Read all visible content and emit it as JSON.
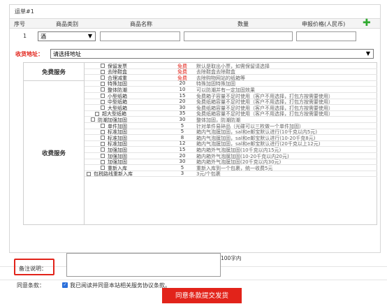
{
  "order": {
    "title": "运单#1",
    "headers": [
      "序号",
      "商品类别",
      "商品名称",
      "数量",
      "申报价格(人民币)"
    ],
    "row_index": "1",
    "category": "酒",
    "add_icon": "plus-icon"
  },
  "address": {
    "label": "收货地址：",
    "placeholder": "请选择地址"
  },
  "free_services": {
    "label": "免费服务",
    "items": [
      {
        "name": "保留发票",
        "price": "免费",
        "desc": "默认是取出小票，如需保留请选择"
      },
      {
        "name": "去除鞋盒",
        "price": "免费",
        "desc": "去除鞋盒去除鞋盒"
      },
      {
        "name": "合理减重",
        "price": "免费",
        "desc": "去除购物网站的纸箱等"
      }
    ]
  },
  "paid_services": {
    "label": "收费服务",
    "items": [
      {
        "name": "特殊加固",
        "price": "20",
        "desc": "特殊加固特殊加固"
      },
      {
        "name": "整体防潮",
        "price": "10",
        "desc": "可以防潮并有一定加固效果"
      },
      {
        "name": "小型纸箱",
        "price": "15",
        "desc": "免费箱子容量不足时使用（客户不用选择，打包方按需要使用）"
      },
      {
        "name": "中型纸箱",
        "price": "20",
        "desc": "免费纸箱容量不足时使用（客户不用选择，打包方按需要使用）"
      },
      {
        "name": "大型纸箱",
        "price": "30",
        "desc": "免费纸箱容量不足时使用（客户不用选择，打包方按需要使用）"
      },
      {
        "name": "超大型纸箱",
        "price": "35",
        "desc": "免费纸箱容量不足时使用（客户不用选择，打包方按需要使用）"
      },
      {
        "name": "防潮加强加固",
        "price": "30",
        "desc": "整体加固，防潮防潮"
      },
      {
        "name": "单件加固",
        "price": "5",
        "desc": "针对单件易碎品（光碟可以三枚做一个单件加固）"
      },
      {
        "name": "标准加固",
        "price": "5",
        "desc": "箱内气泡膜加固，sal和e邮宝默认进行(10千克以内5元)"
      },
      {
        "name": "标准加固",
        "price": "8",
        "desc": "箱内气泡膜加固，sal和e邮宝默认进行(10-20千克8元)"
      },
      {
        "name": "标准加固",
        "price": "12",
        "desc": "箱内气泡膜加固，sal和e邮宝默认进行(20千克以上12元)"
      },
      {
        "name": "加强加固",
        "price": "15",
        "desc": "箱内箱外气泡膜加固(10千克以内15元)"
      },
      {
        "name": "加强加固",
        "price": "20",
        "desc": "箱内箱外气泡膜加固(10-20千克以内20元)"
      },
      {
        "name": "加强加固",
        "price": "30",
        "desc": "箱内箱外气泡膜加固(20千克以内30元)"
      },
      {
        "name": "重新入库",
        "price": "5",
        "desc": "重新入库到一个包裹，统一收费5元"
      },
      {
        "name": "包税路线重新入库",
        "price": "3",
        "desc": "3元/个包裹"
      }
    ]
  },
  "note": {
    "label": "备注说明：",
    "limit": "100字内"
  },
  "agreement": {
    "label": "同意条款：",
    "text": "我已阅读并同意本站相关服务协议条款。",
    "check_icon": "checkmark-icon"
  },
  "submit_label": "同意条款提交发货",
  "colors": {
    "accent_red": "#e2231a",
    "add_green": "#2faa2f",
    "checkbox_blue": "#2a6fdb",
    "header_bg": "#f4f4f4"
  }
}
